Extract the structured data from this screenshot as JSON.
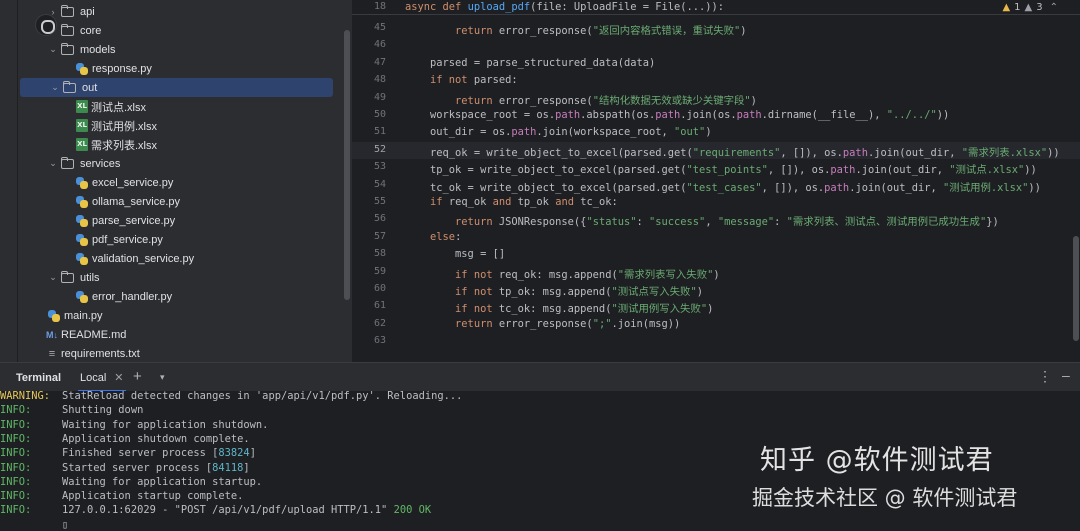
{
  "tree": {
    "items": [
      {
        "label": "api",
        "type": "folder",
        "chev": "›",
        "indent": 1,
        "sel": false
      },
      {
        "label": "core",
        "type": "folder",
        "chev": "›",
        "indent": 1,
        "sel": false
      },
      {
        "label": "models",
        "type": "folder",
        "chev": "⌄",
        "indent": 1,
        "sel": false
      },
      {
        "label": "response.py",
        "type": "py",
        "chev": "",
        "indent": 2,
        "sel": false
      },
      {
        "label": "out",
        "type": "folder",
        "chev": "⌄",
        "indent": 1,
        "sel": true
      },
      {
        "label": "测试点.xlsx",
        "type": "xls",
        "chev": "",
        "indent": 2,
        "sel": false
      },
      {
        "label": "测试用例.xlsx",
        "type": "xls",
        "chev": "",
        "indent": 2,
        "sel": false
      },
      {
        "label": "需求列表.xlsx",
        "type": "xls",
        "chev": "",
        "indent": 2,
        "sel": false
      },
      {
        "label": "services",
        "type": "folder",
        "chev": "⌄",
        "indent": 1,
        "sel": false
      },
      {
        "label": "excel_service.py",
        "type": "py",
        "chev": "",
        "indent": 2,
        "sel": false
      },
      {
        "label": "ollama_service.py",
        "type": "py",
        "chev": "",
        "indent": 2,
        "sel": false
      },
      {
        "label": "parse_service.py",
        "type": "py",
        "chev": "",
        "indent": 2,
        "sel": false
      },
      {
        "label": "pdf_service.py",
        "type": "py",
        "chev": "",
        "indent": 2,
        "sel": false
      },
      {
        "label": "validation_service.py",
        "type": "py",
        "chev": "",
        "indent": 2,
        "sel": false
      },
      {
        "label": "utils",
        "type": "folder",
        "chev": "⌄",
        "indent": 1,
        "sel": false
      },
      {
        "label": "error_handler.py",
        "type": "py",
        "chev": "",
        "indent": 2,
        "sel": false
      },
      {
        "label": "main.py",
        "type": "py",
        "chev": "",
        "indent": 1,
        "sel": false
      },
      {
        "label": "README.md",
        "type": "md",
        "chev": "",
        "indent": 0,
        "sel": false
      },
      {
        "label": "requirements.txt",
        "type": "txt",
        "chev": "",
        "indent": 0,
        "sel": false
      }
    ]
  },
  "editor": {
    "sticky": {
      "num": "18",
      "code": [
        [
          "kw",
          "async def "
        ],
        [
          "fn",
          "upload_pdf"
        ],
        [
          "",
          "(file: UploadFile = File(...)):"
        ]
      ]
    },
    "inspections": {
      "warnings": "1",
      "weak": "3"
    },
    "current_line": "52",
    "lines": [
      {
        "num": "45",
        "code": [
          [
            "",
            "        "
          ],
          [
            "kw",
            "return "
          ],
          [
            "",
            "error_response("
          ],
          [
            "st",
            "\"返回内容格式错误，重试失败\""
          ],
          [
            "",
            ")"
          ]
        ]
      },
      {
        "num": "46",
        "code": []
      },
      {
        "num": "47",
        "code": [
          [
            "",
            "    parsed = parse_structured_data(data)"
          ]
        ]
      },
      {
        "num": "48",
        "code": [
          [
            "",
            "    "
          ],
          [
            "kw",
            "if not "
          ],
          [
            "",
            "parsed:"
          ]
        ]
      },
      {
        "num": "49",
        "code": [
          [
            "",
            "        "
          ],
          [
            "kw",
            "return "
          ],
          [
            "",
            "error_response("
          ],
          [
            "st",
            "\"结构化数据无效或缺少关键字段\""
          ],
          [
            "",
            ")"
          ]
        ]
      },
      {
        "num": "50",
        "code": [
          [
            "",
            "    workspace_root = os."
          ],
          [
            "mod",
            "path"
          ],
          [
            "",
            ".abspath(os."
          ],
          [
            "mod",
            "path"
          ],
          [
            "",
            ".join(os."
          ],
          [
            "mod",
            "path"
          ],
          [
            "",
            ".dirname(__file__), "
          ],
          [
            "st",
            "\"../../\""
          ],
          [
            "",
            "))"
          ]
        ]
      },
      {
        "num": "51",
        "code": [
          [
            "",
            "    out_dir = os."
          ],
          [
            "mod",
            "path"
          ],
          [
            "",
            ".join(workspace_root, "
          ],
          [
            "st",
            "\"out\""
          ],
          [
            "",
            ")"
          ]
        ]
      },
      {
        "num": "52",
        "code": [
          [
            "",
            "    req_ok = write_object_to_excel(parsed.get("
          ],
          [
            "st",
            "\"requirements\""
          ],
          [
            "",
            ", []), os."
          ],
          [
            "mod",
            "path"
          ],
          [
            "",
            ".join(out_dir, "
          ],
          [
            "st",
            "\"需求列表.xlsx\""
          ],
          [
            "",
            "))"
          ]
        ]
      },
      {
        "num": "53",
        "code": [
          [
            "",
            "    tp_ok = write_object_to_excel(parsed.get("
          ],
          [
            "st",
            "\"test_points\""
          ],
          [
            "",
            ", []), os."
          ],
          [
            "mod",
            "path"
          ],
          [
            "",
            ".join(out_dir, "
          ],
          [
            "st",
            "\"测试点.xlsx\""
          ],
          [
            "",
            "))"
          ]
        ]
      },
      {
        "num": "54",
        "code": [
          [
            "",
            "    tc_ok = write_object_to_excel(parsed.get("
          ],
          [
            "st",
            "\"test_cases\""
          ],
          [
            "",
            ", []), os."
          ],
          [
            "mod",
            "path"
          ],
          [
            "",
            ".join(out_dir, "
          ],
          [
            "st",
            "\"测试用例.xlsx\""
          ],
          [
            "",
            "))"
          ]
        ]
      },
      {
        "num": "55",
        "code": [
          [
            "",
            "    "
          ],
          [
            "kw",
            "if "
          ],
          [
            "",
            "req_ok "
          ],
          [
            "kw",
            "and "
          ],
          [
            "",
            "tp_ok "
          ],
          [
            "kw",
            "and "
          ],
          [
            "",
            "tc_ok:"
          ]
        ]
      },
      {
        "num": "56",
        "code": [
          [
            "",
            "        "
          ],
          [
            "kw",
            "return "
          ],
          [
            "",
            "JSONResponse({"
          ],
          [
            "st",
            "\"status\""
          ],
          [
            "",
            ": "
          ],
          [
            "st",
            "\"success\""
          ],
          [
            "",
            ", "
          ],
          [
            "st",
            "\"message\""
          ],
          [
            "",
            ": "
          ],
          [
            "st",
            "\"需求列表、测试点、测试用例已成功生成\""
          ],
          [
            "",
            "})"
          ]
        ]
      },
      {
        "num": "57",
        "code": [
          [
            "",
            "    "
          ],
          [
            "kw",
            "else"
          ],
          [
            "",
            ":"
          ]
        ]
      },
      {
        "num": "58",
        "code": [
          [
            "",
            "        msg = []"
          ]
        ]
      },
      {
        "num": "59",
        "code": [
          [
            "",
            "        "
          ],
          [
            "kw",
            "if not "
          ],
          [
            "",
            "req_ok: msg.append("
          ],
          [
            "st",
            "\"需求列表写入失败\""
          ],
          [
            "",
            ")"
          ]
        ]
      },
      {
        "num": "60",
        "code": [
          [
            "",
            "        "
          ],
          [
            "kw",
            "if not "
          ],
          [
            "",
            "tp_ok: msg.append("
          ],
          [
            "st",
            "\"测试点写入失败\""
          ],
          [
            "",
            ")"
          ]
        ]
      },
      {
        "num": "61",
        "code": [
          [
            "",
            "        "
          ],
          [
            "kw",
            "if not "
          ],
          [
            "",
            "tc_ok: msg.append("
          ],
          [
            "st",
            "\"测试用例写入失败\""
          ],
          [
            "",
            ")"
          ]
        ]
      },
      {
        "num": "62",
        "code": [
          [
            "",
            "        "
          ],
          [
            "kw",
            "return "
          ],
          [
            "",
            "error_response("
          ],
          [
            "st",
            "\";\""
          ],
          [
            "",
            ".join(msg))"
          ]
        ]
      },
      {
        "num": "63",
        "code": []
      }
    ]
  },
  "terminal": {
    "title": "Terminal",
    "tab": "Local",
    "lines": [
      {
        "level": "WARNING:",
        "warn": true,
        "parts": [
          [
            "",
            "StatReload detected changes in 'app/api/v1/pdf.py'. Reloading..."
          ]
        ]
      },
      {
        "level": "INFO:",
        "warn": false,
        "parts": [
          [
            "",
            "Shutting down"
          ]
        ]
      },
      {
        "level": "INFO:",
        "warn": false,
        "parts": [
          [
            "",
            "Waiting for application shutdown."
          ]
        ]
      },
      {
        "level": "INFO:",
        "warn": false,
        "parts": [
          [
            "",
            "Application shutdown complete."
          ]
        ]
      },
      {
        "level": "INFO:",
        "warn": false,
        "parts": [
          [
            "",
            "Finished server process ["
          ],
          [
            "num",
            "83824"
          ],
          [
            "",
            "]"
          ]
        ]
      },
      {
        "level": "INFO:",
        "warn": false,
        "parts": [
          [
            "",
            "Started server process ["
          ],
          [
            "num",
            "84118"
          ],
          [
            "",
            "]"
          ]
        ]
      },
      {
        "level": "INFO:",
        "warn": false,
        "parts": [
          [
            "",
            "Waiting for application startup."
          ]
        ]
      },
      {
        "level": "INFO:",
        "warn": false,
        "parts": [
          [
            "",
            "Application startup complete."
          ]
        ]
      },
      {
        "level": "INFO:",
        "warn": false,
        "parts": [
          [
            "",
            "127.0.0.1:62029 - \"POST /api/v1/pdf/upload HTTP/1.1\" "
          ],
          [
            "ok",
            "200 OK"
          ]
        ]
      },
      {
        "level": "",
        "warn": false,
        "parts": [
          [
            "",
            "▯"
          ]
        ]
      }
    ]
  },
  "watermark": {
    "line1": "知乎 @软件测试君",
    "line2": "掘金技术社区 @ 软件测试君"
  }
}
